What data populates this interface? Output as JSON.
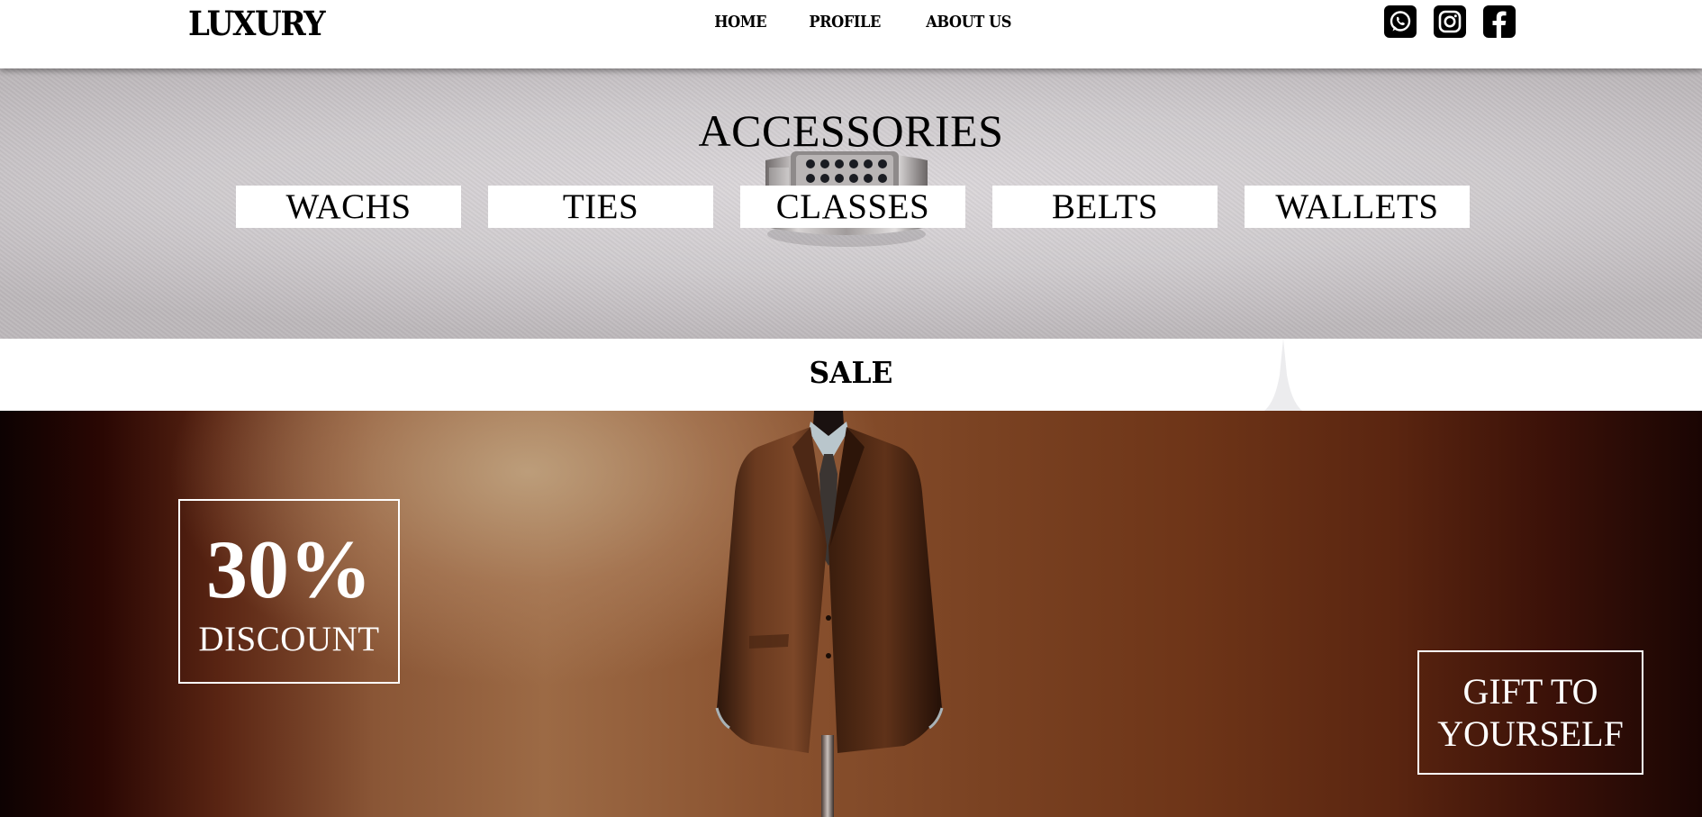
{
  "header": {
    "logo": "LUXURY",
    "nav": [
      {
        "label": "HOME"
      },
      {
        "label": "PROFILE"
      },
      {
        "label": "ABOUT US"
      }
    ],
    "social": [
      {
        "icon": "whatsapp-icon"
      },
      {
        "icon": "instagram-icon"
      },
      {
        "icon": "facebook-icon"
      }
    ]
  },
  "accessories": {
    "title": "ACCESSORIES",
    "categories": [
      "WACHS",
      "TIES",
      "CLASSES",
      "BELTS",
      "WALLETS"
    ]
  },
  "sale": {
    "title": "SALE",
    "discount_value": "30%",
    "discount_label": "DISCOUNT",
    "gift_line1": "GIFT TO",
    "gift_line2": "YOURSELF"
  },
  "colors": {
    "header_bg": "#ffffff",
    "text": "#000000",
    "banner_text": "#ffffff",
    "suit_bg": "#8a5636"
  }
}
